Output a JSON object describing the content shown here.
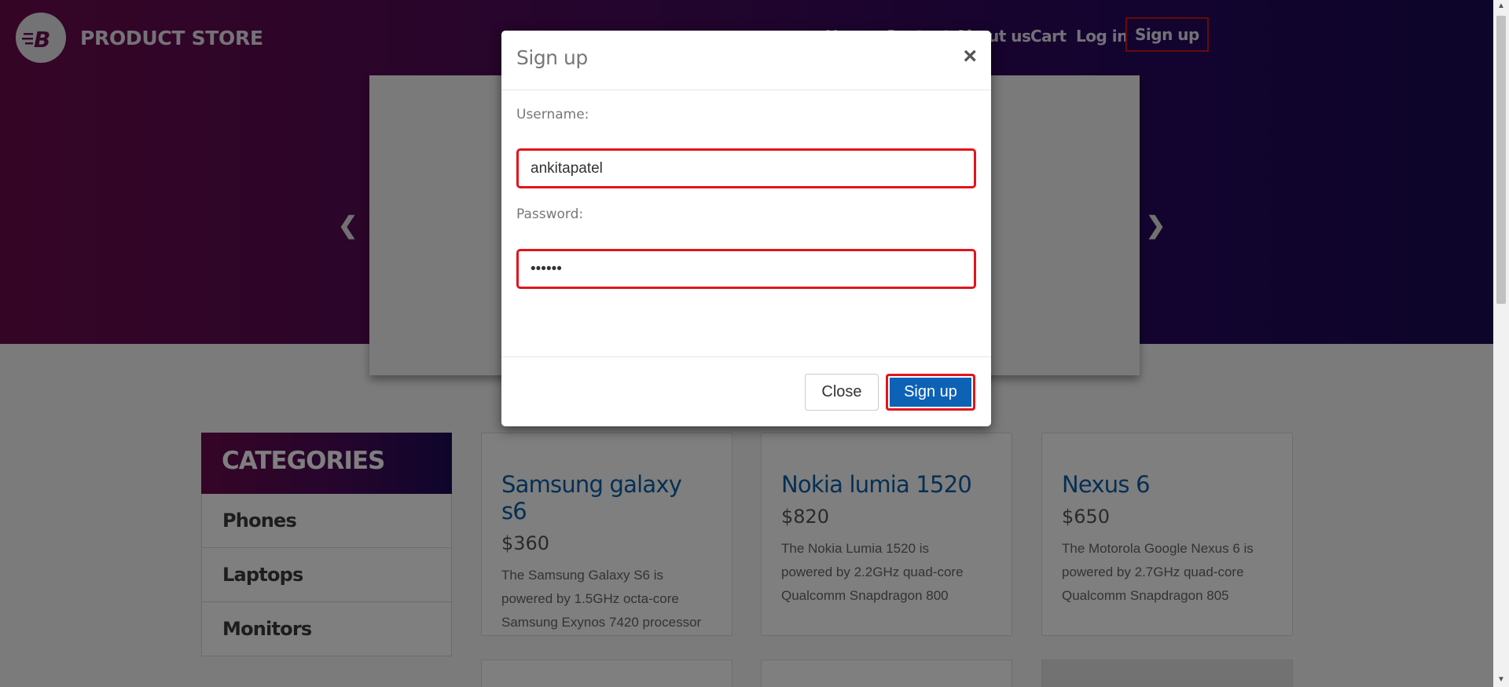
{
  "brand": {
    "name": "PRODUCT STORE",
    "logo_icon": "brand-b-logo-icon"
  },
  "nav": {
    "items": [
      "Home",
      "Contact",
      "About us",
      "Cart",
      "Log in",
      "Sign up"
    ]
  },
  "carousel": {
    "prev_icon": "chevron-left-icon",
    "next_icon": "chevron-right-icon"
  },
  "categories": {
    "title": "CATEGORIES",
    "items": [
      "Phones",
      "Laptops",
      "Monitors"
    ]
  },
  "products": [
    {
      "title": "Samsung galaxy s6",
      "price": "$360",
      "desc": [
        "The Samsung Galaxy S6 is",
        "powered by 1.5GHz octa-core",
        "Samsung Exynos 7420 processor"
      ]
    },
    {
      "title": "Nokia lumia 1520",
      "price": "$820",
      "desc": [
        "The Nokia Lumia 1520 is",
        "powered by 2.2GHz quad-core",
        "Qualcomm Snapdragon 800"
      ]
    },
    {
      "title": "Nexus 6",
      "price": "$650",
      "desc": [
        "The Motorola Google Nexus 6 is",
        "powered by 2.7GHz quad-core",
        "Qualcomm Snapdragon 805"
      ]
    }
  ],
  "modal": {
    "title": "Sign up",
    "close_glyph": "×",
    "username_label": "Username:",
    "username_value": "ankitapatel",
    "password_label": "Password:",
    "password_value": "••••••",
    "close_button": "Close",
    "submit_button": "Sign up"
  },
  "colors": {
    "accent": "#0d62b5",
    "highlight": "#e3141b",
    "hero_start": "#6b0a4c",
    "hero_end": "#1b0a55"
  }
}
